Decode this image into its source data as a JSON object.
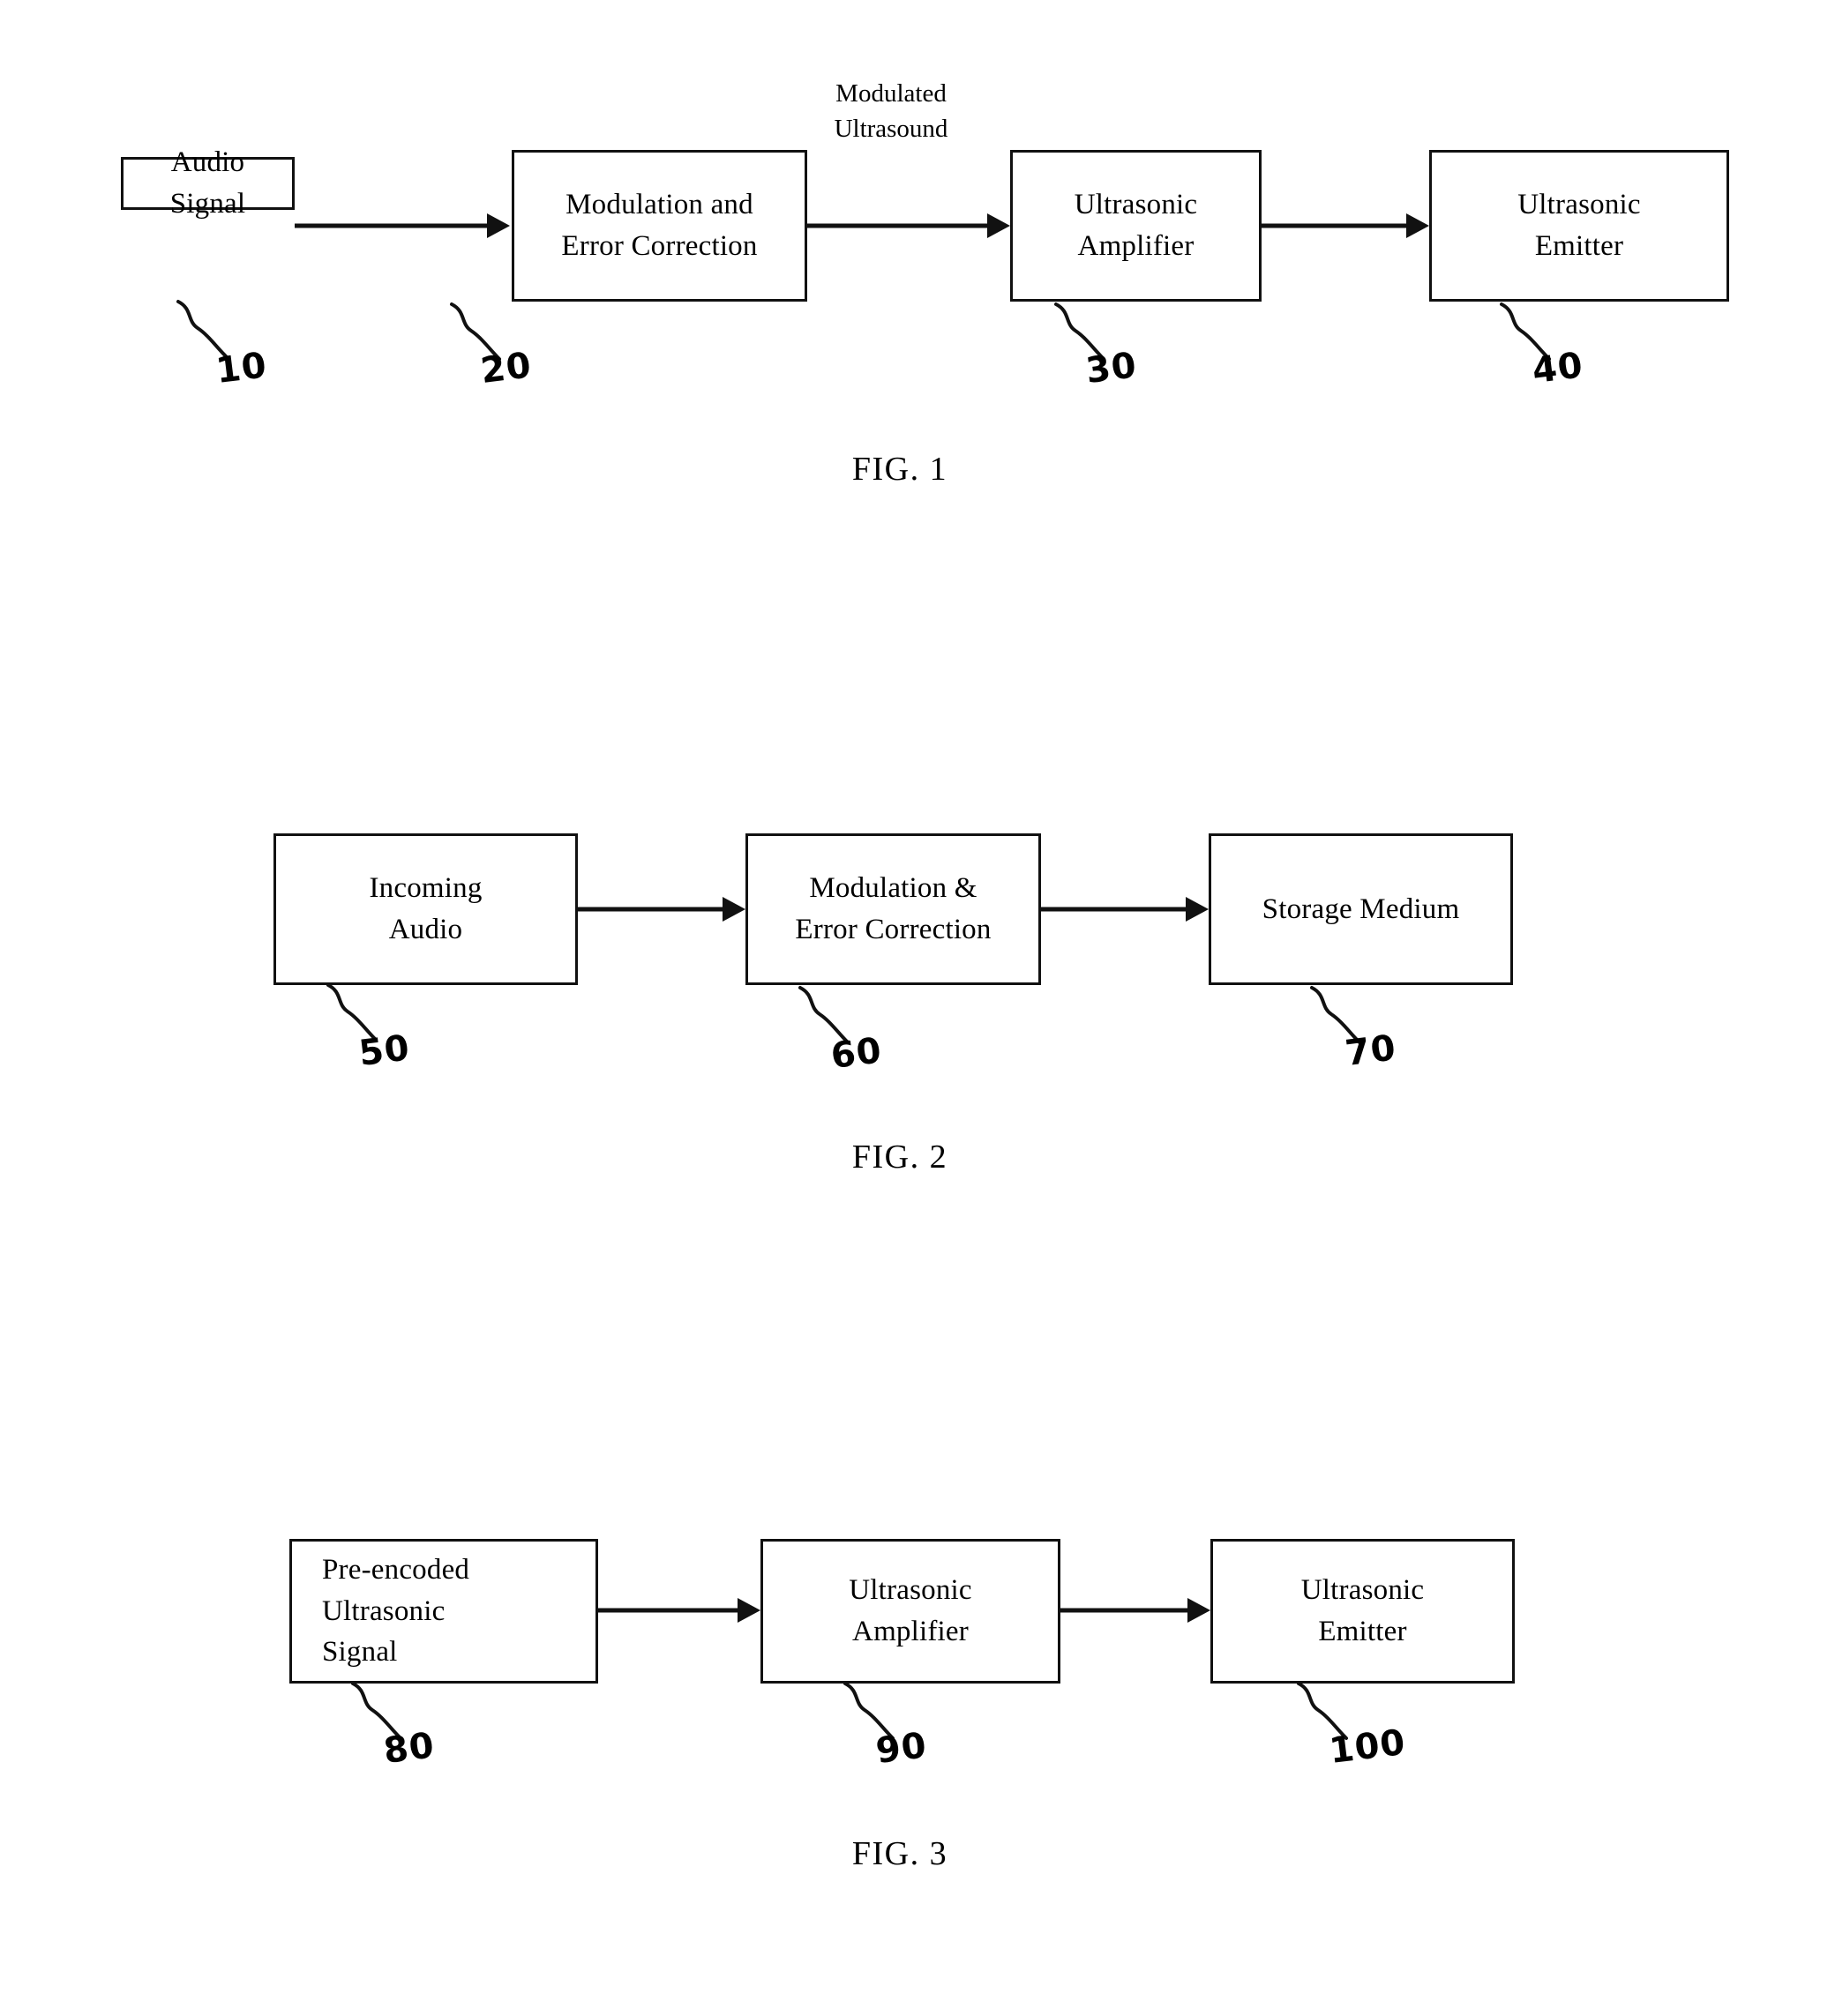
{
  "document": {
    "type": "patent-drawing-sheet",
    "figure_count": 3
  },
  "figures": [
    {
      "id": "fig1",
      "caption": "FIG. 1",
      "boxes": [
        {
          "ref": "10",
          "lines": [
            "Audio",
            "Signal"
          ],
          "align": "center"
        },
        {
          "ref": "20",
          "lines": [
            "Modulation and",
            "Error Correction"
          ],
          "align": "center"
        },
        {
          "ref": "30",
          "lines": [
            "Ultrasonic",
            "Amplifier"
          ],
          "align": "center"
        },
        {
          "ref": "40",
          "lines": [
            "Ultrasonic",
            "Emitter"
          ],
          "align": "center"
        }
      ],
      "flow_labels": [
        {
          "lines": [
            "Modulated",
            "Ultrasound"
          ]
        }
      ]
    },
    {
      "id": "fig2",
      "caption": "FIG. 2",
      "boxes": [
        {
          "ref": "50",
          "lines": [
            "Incoming",
            "Audio"
          ],
          "align": "center"
        },
        {
          "ref": "60",
          "lines": [
            "Modulation &",
            "Error Correction"
          ],
          "align": "center"
        },
        {
          "ref": "70",
          "lines": [
            "Storage Medium"
          ],
          "align": "center"
        }
      ],
      "flow_labels": []
    },
    {
      "id": "fig3",
      "caption": "FIG. 3",
      "boxes": [
        {
          "ref": "80",
          "lines": [
            "Pre-encoded",
            "Ultrasonic",
            "Signal"
          ],
          "align": "left"
        },
        {
          "ref": "90",
          "lines": [
            "Ultrasonic",
            "Amplifier"
          ],
          "align": "center"
        },
        {
          "ref": "100",
          "lines": [
            "Ultrasonic",
            "Emitter"
          ],
          "align": "center"
        }
      ],
      "flow_labels": []
    }
  ],
  "colors": {
    "ink": "#111111",
    "paper": "#ffffff"
  }
}
